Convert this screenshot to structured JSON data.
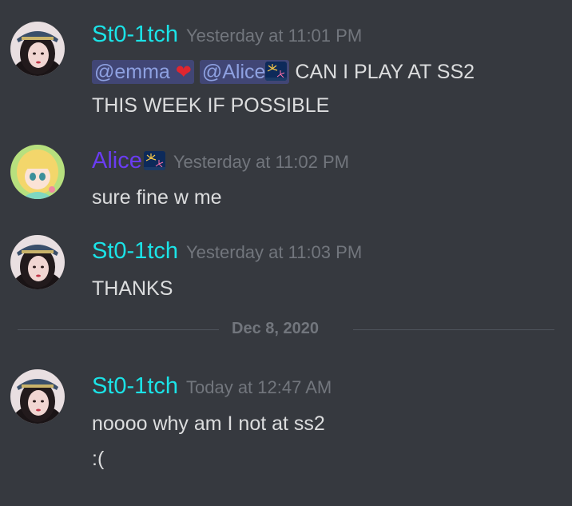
{
  "colors": {
    "background": "#36393f",
    "st01tch_name": "#1be3e7",
    "alice_name": "#6a3cf2",
    "timestamp": "#72767d",
    "mention_bg": "#414675",
    "mention_text": "#8ea1e1"
  },
  "messages": [
    {
      "author": "St0-1tch",
      "timestamp": "Yesterday at 11:01 PM",
      "mention_1": "@emma",
      "mention_2": "@Alice",
      "line1_text": "CAN I PLAY AT SS2",
      "line2_text": "THIS WEEK IF POSSIBLE"
    },
    {
      "author": "Alice",
      "timestamp": "Yesterday at 11:02 PM",
      "line1_text": "sure fine w me"
    },
    {
      "author": "St0-1tch",
      "timestamp": "Yesterday at 11:03 PM",
      "line1_text": "THANKS"
    },
    {
      "author": "St0-1tch",
      "timestamp": "Today at 12:47 AM",
      "line1_text": "noooo why am I not at ss2",
      "line2_text": ":("
    }
  ],
  "date_divider": "Dec 8, 2020",
  "icons": {
    "heart": "red-heart-emoji",
    "fireworks": "fireworks-emoji"
  }
}
